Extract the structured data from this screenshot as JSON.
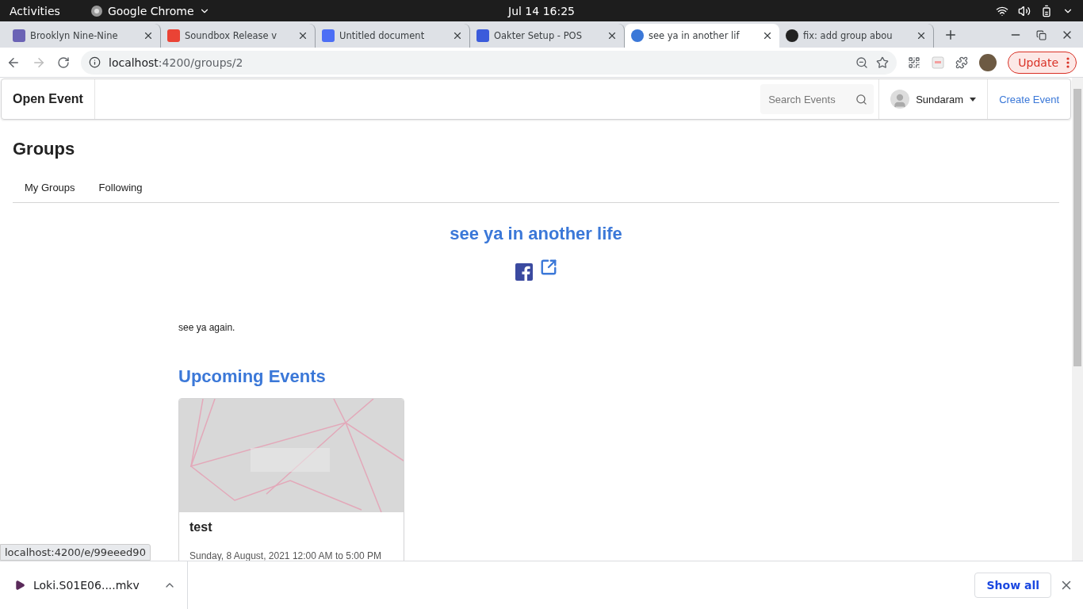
{
  "system_bar": {
    "activities": "Activities",
    "app_name": "Google Chrome",
    "clock": "Jul 14  16:25"
  },
  "browser_tabs": [
    {
      "title": "Brooklyn Nine-Nine",
      "selected": false,
      "color": "#6b63b5"
    },
    {
      "title": "Soundbox Release v",
      "selected": false,
      "color": "#ea4335"
    },
    {
      "title": "Untitled document",
      "selected": false,
      "color": "#4c6ef5"
    },
    {
      "title": "Oakter Setup - POS",
      "selected": false,
      "color": "#3b5bdb"
    },
    {
      "title": "see ya in another lif",
      "selected": true,
      "color": "#3b78d8"
    },
    {
      "title": "fix: add group abou",
      "selected": false,
      "color": "#222222"
    }
  ],
  "address_bar": {
    "host": "localhost",
    "path": ":4200/groups/2"
  },
  "update_button": "Update",
  "navbar": {
    "brand": "Open Event",
    "search": {
      "placeholder": "Search Events"
    },
    "user": "Sundaram",
    "create": "Create Event"
  },
  "heading": "Groups",
  "group_tabs": [
    {
      "label": "My Groups",
      "selected": false
    },
    {
      "label": "Following",
      "selected": false
    }
  ],
  "group": {
    "title": "see ya in another life",
    "description": "see ya again."
  },
  "section_title": "Upcoming Events",
  "events": [
    {
      "kind": "picture",
      "name": "test",
      "date": "Sunday, 8 August, 2021 12:00 AM to 5:00 PM"
    }
  ],
  "status_tooltip": "localhost:4200/e/99eeed90",
  "downloads": {
    "file": "Loki.S01E06....mkv",
    "show_all": "Show all"
  }
}
